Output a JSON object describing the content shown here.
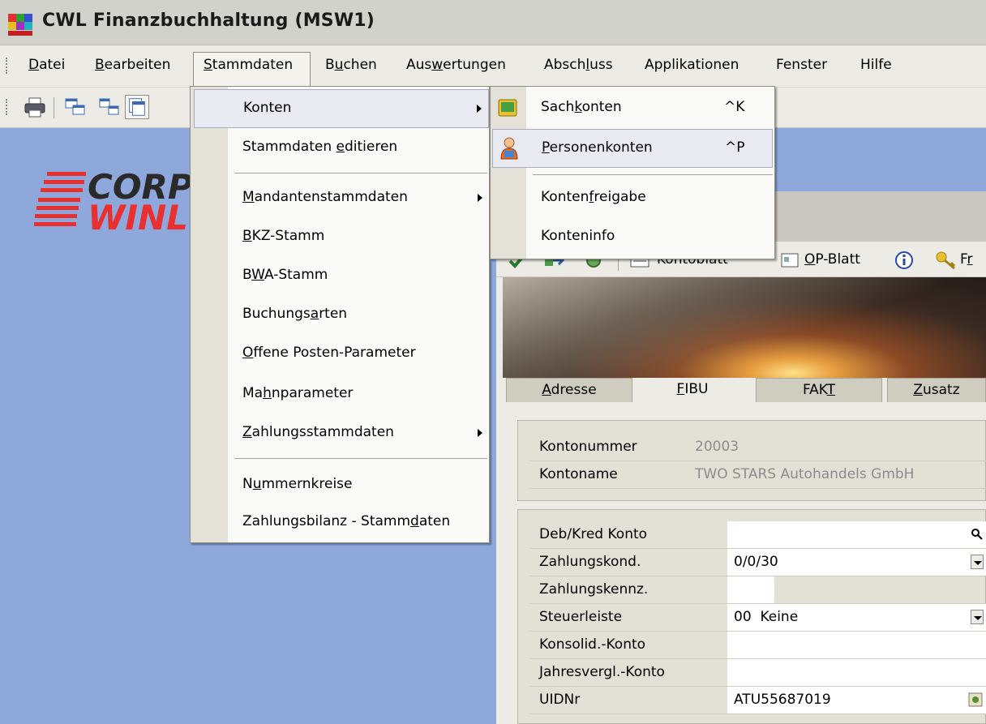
{
  "window": {
    "title": "CWL Finanzbuchhaltung (MSW1)"
  },
  "menubar": [
    {
      "key": "datei",
      "pre": "",
      "ul": "D",
      "post": "atei"
    },
    {
      "key": "bearbeiten",
      "pre": "",
      "ul": "B",
      "post": "earbeiten"
    },
    {
      "key": "stammdaten",
      "pre": "",
      "ul": "S",
      "post": "tammdaten"
    },
    {
      "key": "buchen",
      "pre": "B",
      "ul": "u",
      "post": "chen"
    },
    {
      "key": "auswertungen",
      "pre": "Aus",
      "ul": "w",
      "post": "ertungen"
    },
    {
      "key": "abschluss",
      "pre": "Absch",
      "ul": "l",
      "post": "uss"
    },
    {
      "key": "applikationen",
      "pre": "Applikationen",
      "ul": "",
      "post": ""
    },
    {
      "key": "fenster",
      "pre": "Fenster",
      "ul": "",
      "post": ""
    },
    {
      "key": "hilfe",
      "pre": "Hilfe",
      "ul": "",
      "post": ""
    }
  ],
  "logo": {
    "line1": "CORPO",
    "line2": "WINL"
  },
  "stammdaten_menu": [
    {
      "pre": "Konten",
      "ul": "",
      "post": "",
      "submenu": true
    },
    {
      "pre": "Stammdaten ",
      "ul": "e",
      "post": "ditieren",
      "submenu": false
    },
    {
      "pre": "",
      "ul": "M",
      "post": "andantenstammdaten",
      "submenu": true
    },
    {
      "pre": "",
      "ul": "B",
      "post": "KZ-Stamm",
      "submenu": false
    },
    {
      "pre": "B",
      "ul": "W",
      "post": "A-Stamm",
      "submenu": false
    },
    {
      "pre": "Buchungs",
      "ul": "a",
      "post": "rten",
      "submenu": false
    },
    {
      "pre": "",
      "ul": "O",
      "post": "ffene Posten-Parameter",
      "submenu": false
    },
    {
      "pre": "Ma",
      "ul": "h",
      "post": "nparameter",
      "submenu": false
    },
    {
      "pre": "",
      "ul": "Z",
      "post": "ahlungsstammdaten",
      "submenu": true
    },
    {
      "pre": "N",
      "ul": "u",
      "post": "mmernkreise",
      "submenu": false
    },
    {
      "pre": "Zahlungsbilanz - Stamm",
      "ul": "d",
      "post": "aten",
      "submenu": false
    }
  ],
  "konten_submenu": [
    {
      "pre": "Sach",
      "ul": "k",
      "post": "onten",
      "shortcut": "^K",
      "icon": "sachkonten-icon"
    },
    {
      "pre": "",
      "ul": "P",
      "post": "ersonenkonten",
      "shortcut": "^P",
      "icon": "personenkonten-icon"
    },
    {
      "pre": "Konten",
      "ul": "f",
      "post": "reigabe",
      "shortcut": "",
      "icon": ""
    },
    {
      "pre": "Konteninfo",
      "ul": "",
      "post": "",
      "shortcut": "",
      "icon": ""
    }
  ],
  "inner_toolbar": {
    "kontoblatt": "Kontoblatt",
    "opblatt_pre": "",
    "opblatt_ul": "O",
    "opblatt_post": "P-Blatt",
    "freigabe_pre": "F",
    "freigabe_ul": "r"
  },
  "tabs": [
    {
      "pre": "",
      "ul": "A",
      "post": "dresse",
      "active": false
    },
    {
      "pre": "",
      "ul": "F",
      "post": "IBU",
      "active": true
    },
    {
      "pre": "FAK",
      "ul": "T",
      "post": "",
      "active": false
    },
    {
      "pre": "",
      "ul": "Z",
      "post": "usatz",
      "active": false
    }
  ],
  "account": {
    "kontonummer_label": "Kontonummer",
    "kontonummer_value": "20003",
    "kontoname_label": "Kontoname",
    "kontoname_value": "TWO STARS Autohandels GmbH"
  },
  "fibu_fields": [
    {
      "label": "Deb/Kred Konto",
      "value": "",
      "control": "search"
    },
    {
      "label": "Zahlungskond.",
      "value": "0/0/30",
      "control": "dropdown"
    },
    {
      "label": "Zahlungskennz.",
      "value": "",
      "control": "short"
    },
    {
      "label": "Steuerleiste",
      "value": "00  Keine",
      "control": "dropdown"
    },
    {
      "label": "Konsolid.-Konto",
      "value": "",
      "control": "text"
    },
    {
      "label": "Jahresvergl.-Konto",
      "value": "",
      "control": "text"
    },
    {
      "label": "UIDNr",
      "value": "ATU55687019",
      "control": "lookup"
    }
  ]
}
